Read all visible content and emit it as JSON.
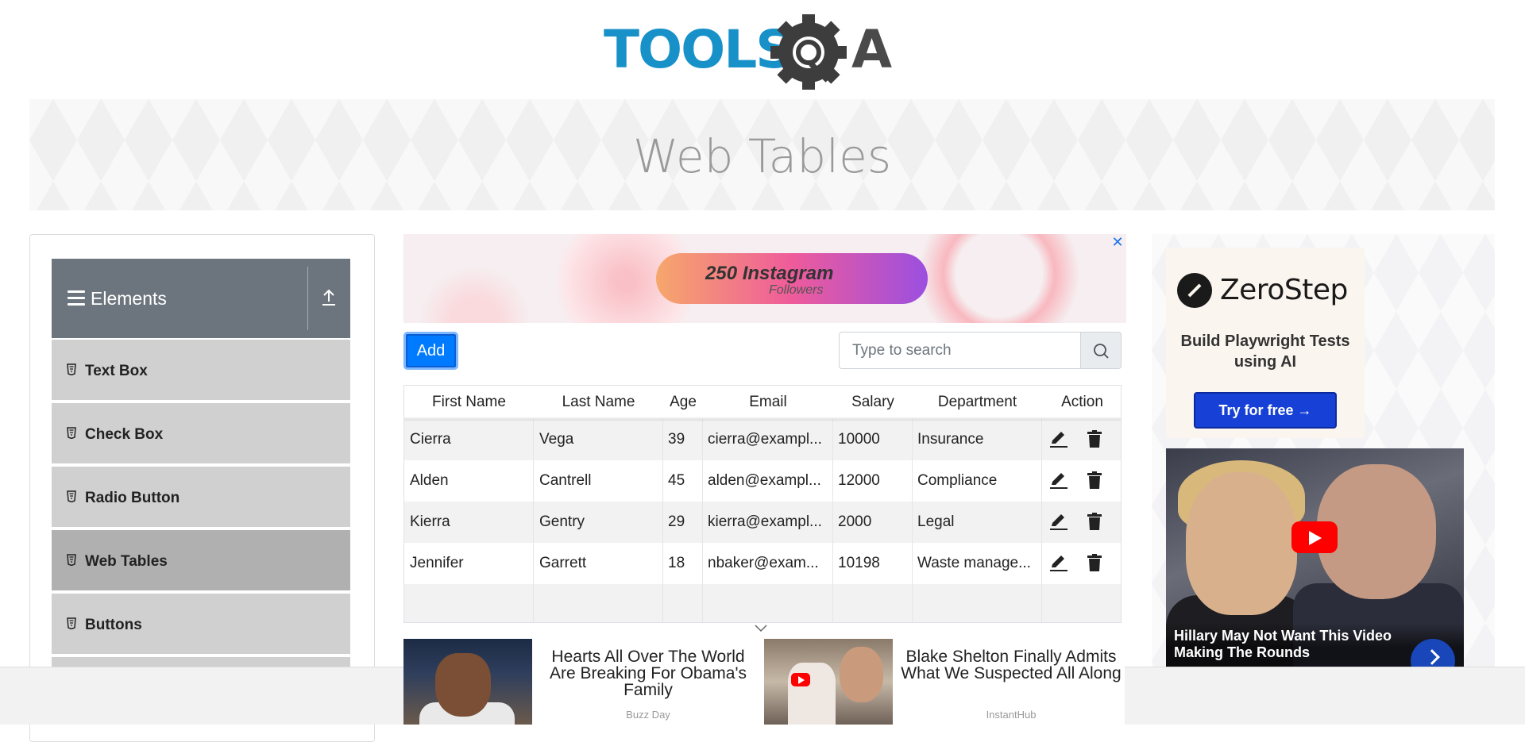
{
  "header": {
    "logo_text_left": "TOOLS",
    "logo_text_right": "A",
    "page_title": "Web Tables"
  },
  "sidebar": {
    "group_title": "Elements",
    "items": [
      {
        "label": "Text Box"
      },
      {
        "label": "Check Box"
      },
      {
        "label": "Radio Button"
      },
      {
        "label": "Web Tables",
        "active": true
      },
      {
        "label": "Buttons"
      }
    ]
  },
  "ad_top": {
    "headline": "250 Instagram",
    "sub": "Followers"
  },
  "toolbar": {
    "add_label": "Add",
    "search_placeholder": "Type to search"
  },
  "table": {
    "columns": [
      "First Name",
      "Last Name",
      "Age",
      "Email",
      "Salary",
      "Department",
      "Action"
    ],
    "rows": [
      {
        "first": "Cierra",
        "last": "Vega",
        "age": "39",
        "email": "cierra@exampl...",
        "salary": "10000",
        "department": "Insurance"
      },
      {
        "first": "Alden",
        "last": "Cantrell",
        "age": "45",
        "email": "alden@exampl...",
        "salary": "12000",
        "department": "Compliance"
      },
      {
        "first": "Kierra",
        "last": "Gentry",
        "age": "29",
        "email": "kierra@exampl...",
        "salary": "2000",
        "department": "Legal"
      },
      {
        "first": "Jennifer",
        "last": "Garrett",
        "age": "18",
        "email": "nbaker@exam...",
        "salary": "10198",
        "department": "Waste manage..."
      }
    ]
  },
  "bottom_ads": [
    {
      "headline": "Hearts All Over The World Are Breaking For Obama's Family",
      "source": "Buzz Day"
    },
    {
      "headline": "Blake Shelton Finally Admits What We Suspected All Along",
      "source": "InstantHub"
    }
  ],
  "right_ad": {
    "brand": "ZeroStep",
    "tagline": "Build Playwright Tests using AI",
    "cta": "Try for free →",
    "video_title": "Hillary May Not Want This Video Making The Rounds"
  },
  "colors": {
    "primary": "#007bff",
    "logo_blue": "#1791c8",
    "logo_gray": "#4a4a4a",
    "sidebar_header": "#6c757d",
    "sidebar_item": "#d0d0d0",
    "sidebar_item_active": "#b0b0b0"
  },
  "icons": [
    "hamburger-icon",
    "upload-icon",
    "html5-icon",
    "search-icon",
    "pencil-icon",
    "trash-icon",
    "chevron-down-icon",
    "close-icon",
    "play-icon",
    "chevron-right-icon"
  ]
}
